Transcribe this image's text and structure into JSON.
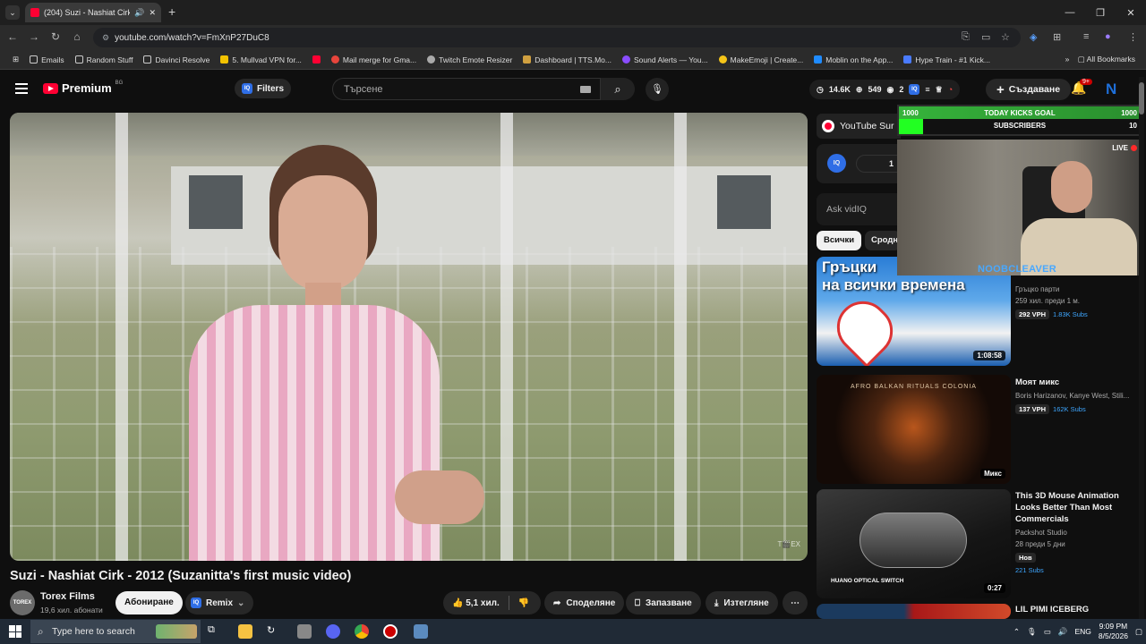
{
  "browser": {
    "tab_title": "(204) Suzi - Nashiat Cirk - 2",
    "url": "youtube.com/watch?v=FmXnP27DuC8",
    "all_bookmarks": "All Bookmarks",
    "bookmarks": [
      "Emails",
      "Random Stuff",
      "Davinci Resolve",
      "5. Mullvad VPN for...",
      "Mail merge for Gma...",
      "Twitch Emote Resizer",
      "Dashboard | TTS.Mo...",
      "Sound Alerts — You...",
      "MakeEmoji | Create...",
      "Moblin on the App...",
      "Hype Train - #1 Kick..."
    ]
  },
  "yt": {
    "brand": "Premium",
    "country": "BG",
    "filters": "Filters",
    "search_placeholder": "Търсене",
    "stats": {
      "views": "14.6K",
      "likes": "549",
      "live": "2"
    },
    "create": "Създаване",
    "notif_count": "9+",
    "avatar_letter": "N"
  },
  "video": {
    "title": "Suzi - Nashiat Cirk - 2012 (Suzanitta's first music video)",
    "channel": "Torex Films",
    "channel_avatar": "TOREX",
    "subscribers": "19,6 хил. абонати",
    "subscribe": "Абониране",
    "remix": "Remix",
    "likes": "5,1 хил.",
    "share": "Споделяне",
    "save": "Запазване",
    "download": "Изтегляне",
    "watermark": "T🎬EX"
  },
  "sidebar": {
    "summary_label": "YouTube Sur",
    "iq_label": "IQ",
    "iq_value": "1",
    "ask_placeholder": "Ask vidIQ",
    "chips": [
      "Всички",
      "Сродн"
    ],
    "items": [
      {
        "thumb_text": "Гръцки\nна всички времена",
        "duration": "1:08:58",
        "title": "",
        "meta1": "Гръцко парти",
        "meta2": "259 хил.  преди 1 м.",
        "vph": "292 VPH",
        "subs": "1.83K Subs"
      },
      {
        "thumb_text": "AFRO BALKAN RITUALS  COLONIA",
        "duration": "Микс",
        "title": "Моят микс",
        "meta1": "Boris Harizanov, Kanye West, Stili...",
        "meta2": "",
        "vph": "137 VPH",
        "subs": "162K Subs"
      },
      {
        "thumb_text": "HUANO OPTICAL SWITCH",
        "duration": "0:27",
        "title": "This 3D Mouse Animation Looks Better Than Most Commercials",
        "meta1": "Packshot Studio",
        "meta2": "28  преди 5 дни",
        "badge": "Нов",
        "subs": "221 Subs"
      },
      {
        "title": "LIL PIMI ICEBERG"
      }
    ]
  },
  "overlay": {
    "goal_left": "1000",
    "goal_title": "TODAY KICKS GOAL",
    "goal_right": "1000",
    "goal_progress": 0.1,
    "subs_label": "SUBSCRIBERS",
    "subs_right": "10",
    "live": "LIVE",
    "streamer": "NOOBCLEAVER"
  },
  "taskbar": {
    "search": "Type here to search",
    "lang": "ENG",
    "time": "9:09 PM",
    "date": "8/5/2026"
  }
}
